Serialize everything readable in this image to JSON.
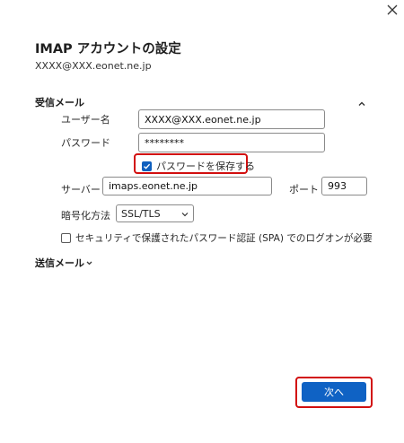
{
  "dialog": {
    "close_icon": "close-icon",
    "title": "IMAP アカウントの設定",
    "account": "XXXX@XXX.eonet.ne.jp"
  },
  "incoming": {
    "header": "受信メール",
    "collapse_icon": "chevron-up-icon",
    "username_label": "ユーザー名",
    "username_value": "XXXX@XXX.eonet.ne.jp",
    "password_label": "パスワード",
    "password_value": "********",
    "save_password_label": "パスワードを保存する",
    "save_password_checked": true,
    "server_label": "サーバー",
    "server_value": "imaps.eonet.ne.jp",
    "port_label": "ポート",
    "port_value": "993",
    "encryption_label": "暗号化方法",
    "encryption_value": "SSL/TLS",
    "spa_label": "セキュリティで保護されたパスワード認証 (SPA) でのログオンが必要",
    "spa_checked": false
  },
  "outgoing": {
    "header": "送信メール",
    "expand_icon": "chevron-down-icon"
  },
  "footer": {
    "next_label": "次へ"
  },
  "colors": {
    "accent": "#0f62c4",
    "highlight": "#d20f0f"
  }
}
